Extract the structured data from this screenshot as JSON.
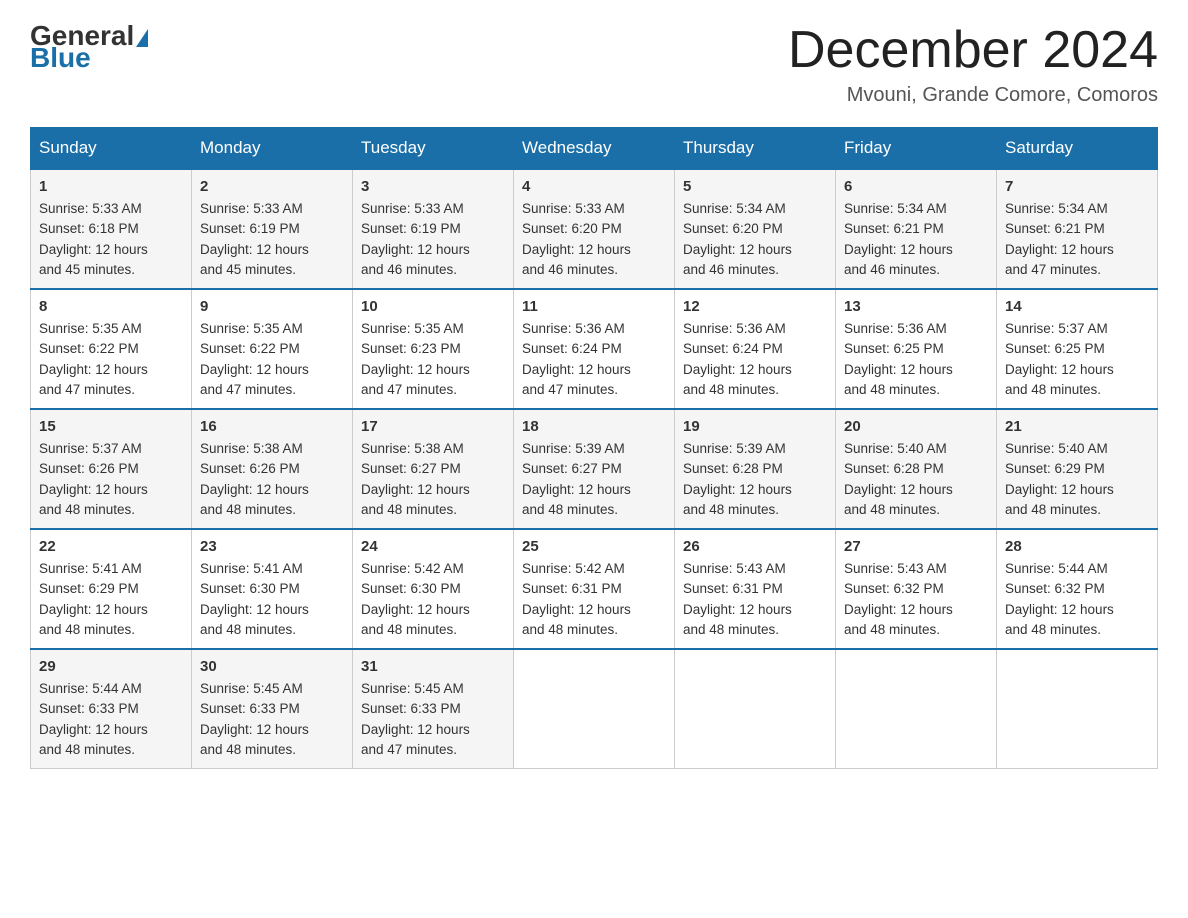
{
  "header": {
    "logo_general": "General",
    "logo_blue": "Blue",
    "month_title": "December 2024",
    "location": "Mvouni, Grande Comore, Comoros"
  },
  "days_of_week": [
    "Sunday",
    "Monday",
    "Tuesday",
    "Wednesday",
    "Thursday",
    "Friday",
    "Saturday"
  ],
  "weeks": [
    [
      {
        "day": "1",
        "sunrise": "5:33 AM",
        "sunset": "6:18 PM",
        "daylight": "12 hours and 45 minutes."
      },
      {
        "day": "2",
        "sunrise": "5:33 AM",
        "sunset": "6:19 PM",
        "daylight": "12 hours and 45 minutes."
      },
      {
        "day": "3",
        "sunrise": "5:33 AM",
        "sunset": "6:19 PM",
        "daylight": "12 hours and 46 minutes."
      },
      {
        "day": "4",
        "sunrise": "5:33 AM",
        "sunset": "6:20 PM",
        "daylight": "12 hours and 46 minutes."
      },
      {
        "day": "5",
        "sunrise": "5:34 AM",
        "sunset": "6:20 PM",
        "daylight": "12 hours and 46 minutes."
      },
      {
        "day": "6",
        "sunrise": "5:34 AM",
        "sunset": "6:21 PM",
        "daylight": "12 hours and 46 minutes."
      },
      {
        "day": "7",
        "sunrise": "5:34 AM",
        "sunset": "6:21 PM",
        "daylight": "12 hours and 47 minutes."
      }
    ],
    [
      {
        "day": "8",
        "sunrise": "5:35 AM",
        "sunset": "6:22 PM",
        "daylight": "12 hours and 47 minutes."
      },
      {
        "day": "9",
        "sunrise": "5:35 AM",
        "sunset": "6:22 PM",
        "daylight": "12 hours and 47 minutes."
      },
      {
        "day": "10",
        "sunrise": "5:35 AM",
        "sunset": "6:23 PM",
        "daylight": "12 hours and 47 minutes."
      },
      {
        "day": "11",
        "sunrise": "5:36 AM",
        "sunset": "6:24 PM",
        "daylight": "12 hours and 47 minutes."
      },
      {
        "day": "12",
        "sunrise": "5:36 AM",
        "sunset": "6:24 PM",
        "daylight": "12 hours and 48 minutes."
      },
      {
        "day": "13",
        "sunrise": "5:36 AM",
        "sunset": "6:25 PM",
        "daylight": "12 hours and 48 minutes."
      },
      {
        "day": "14",
        "sunrise": "5:37 AM",
        "sunset": "6:25 PM",
        "daylight": "12 hours and 48 minutes."
      }
    ],
    [
      {
        "day": "15",
        "sunrise": "5:37 AM",
        "sunset": "6:26 PM",
        "daylight": "12 hours and 48 minutes."
      },
      {
        "day": "16",
        "sunrise": "5:38 AM",
        "sunset": "6:26 PM",
        "daylight": "12 hours and 48 minutes."
      },
      {
        "day": "17",
        "sunrise": "5:38 AM",
        "sunset": "6:27 PM",
        "daylight": "12 hours and 48 minutes."
      },
      {
        "day": "18",
        "sunrise": "5:39 AM",
        "sunset": "6:27 PM",
        "daylight": "12 hours and 48 minutes."
      },
      {
        "day": "19",
        "sunrise": "5:39 AM",
        "sunset": "6:28 PM",
        "daylight": "12 hours and 48 minutes."
      },
      {
        "day": "20",
        "sunrise": "5:40 AM",
        "sunset": "6:28 PM",
        "daylight": "12 hours and 48 minutes."
      },
      {
        "day": "21",
        "sunrise": "5:40 AM",
        "sunset": "6:29 PM",
        "daylight": "12 hours and 48 minutes."
      }
    ],
    [
      {
        "day": "22",
        "sunrise": "5:41 AM",
        "sunset": "6:29 PM",
        "daylight": "12 hours and 48 minutes."
      },
      {
        "day": "23",
        "sunrise": "5:41 AM",
        "sunset": "6:30 PM",
        "daylight": "12 hours and 48 minutes."
      },
      {
        "day": "24",
        "sunrise": "5:42 AM",
        "sunset": "6:30 PM",
        "daylight": "12 hours and 48 minutes."
      },
      {
        "day": "25",
        "sunrise": "5:42 AM",
        "sunset": "6:31 PM",
        "daylight": "12 hours and 48 minutes."
      },
      {
        "day": "26",
        "sunrise": "5:43 AM",
        "sunset": "6:31 PM",
        "daylight": "12 hours and 48 minutes."
      },
      {
        "day": "27",
        "sunrise": "5:43 AM",
        "sunset": "6:32 PM",
        "daylight": "12 hours and 48 minutes."
      },
      {
        "day": "28",
        "sunrise": "5:44 AM",
        "sunset": "6:32 PM",
        "daylight": "12 hours and 48 minutes."
      }
    ],
    [
      {
        "day": "29",
        "sunrise": "5:44 AM",
        "sunset": "6:33 PM",
        "daylight": "12 hours and 48 minutes."
      },
      {
        "day": "30",
        "sunrise": "5:45 AM",
        "sunset": "6:33 PM",
        "daylight": "12 hours and 48 minutes."
      },
      {
        "day": "31",
        "sunrise": "5:45 AM",
        "sunset": "6:33 PM",
        "daylight": "12 hours and 47 minutes."
      },
      null,
      null,
      null,
      null
    ]
  ],
  "labels": {
    "sunrise": "Sunrise:",
    "sunset": "Sunset:",
    "daylight": "Daylight:"
  }
}
